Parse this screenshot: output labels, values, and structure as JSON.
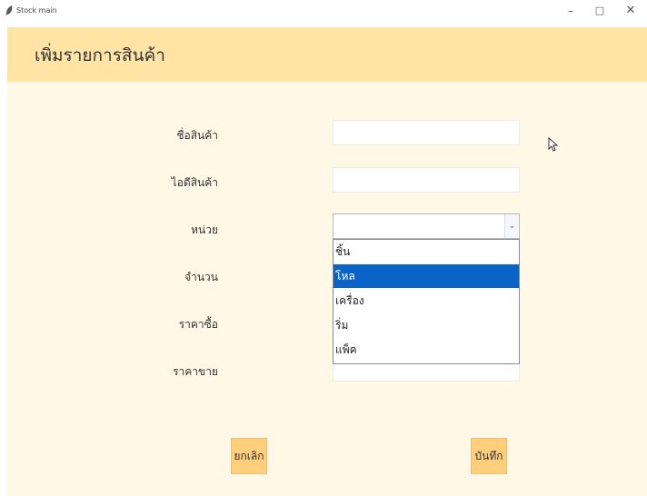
{
  "window": {
    "title": "Stock main",
    "minimize": "–",
    "maximize": "□",
    "close": "✕"
  },
  "header": {
    "title": "เพิ่มรายการสินค้า"
  },
  "form": {
    "product_name_label": "ชื่อสินค้า",
    "product_id_label": "ไอดีสินค้า",
    "unit_label": "หน่วย",
    "quantity_label": "จำนวน",
    "buy_price_label": "ราคาซื้อ",
    "sell_price_label": "ราคาขาย",
    "product_name_value": "",
    "product_id_value": "",
    "unit_value": "",
    "sell_price_value": ""
  },
  "unit_options": [
    "ชิ้น",
    "โหล",
    "เครื่อง",
    "ริ่ม",
    "แพ็ค"
  ],
  "unit_selected_index": 1,
  "buttons": {
    "cancel": "ยกเลิก",
    "save": "บันทึก"
  },
  "colors": {
    "header_bg": "#ffe4a6",
    "content_bg": "#fff8e6",
    "button_bg": "#ffcf7d",
    "selection": "#0a64c8"
  },
  "icons": {
    "app": "feather-icon",
    "combo_arrow": "chevron-down-icon",
    "cursor": "mouse-pointer-icon"
  }
}
